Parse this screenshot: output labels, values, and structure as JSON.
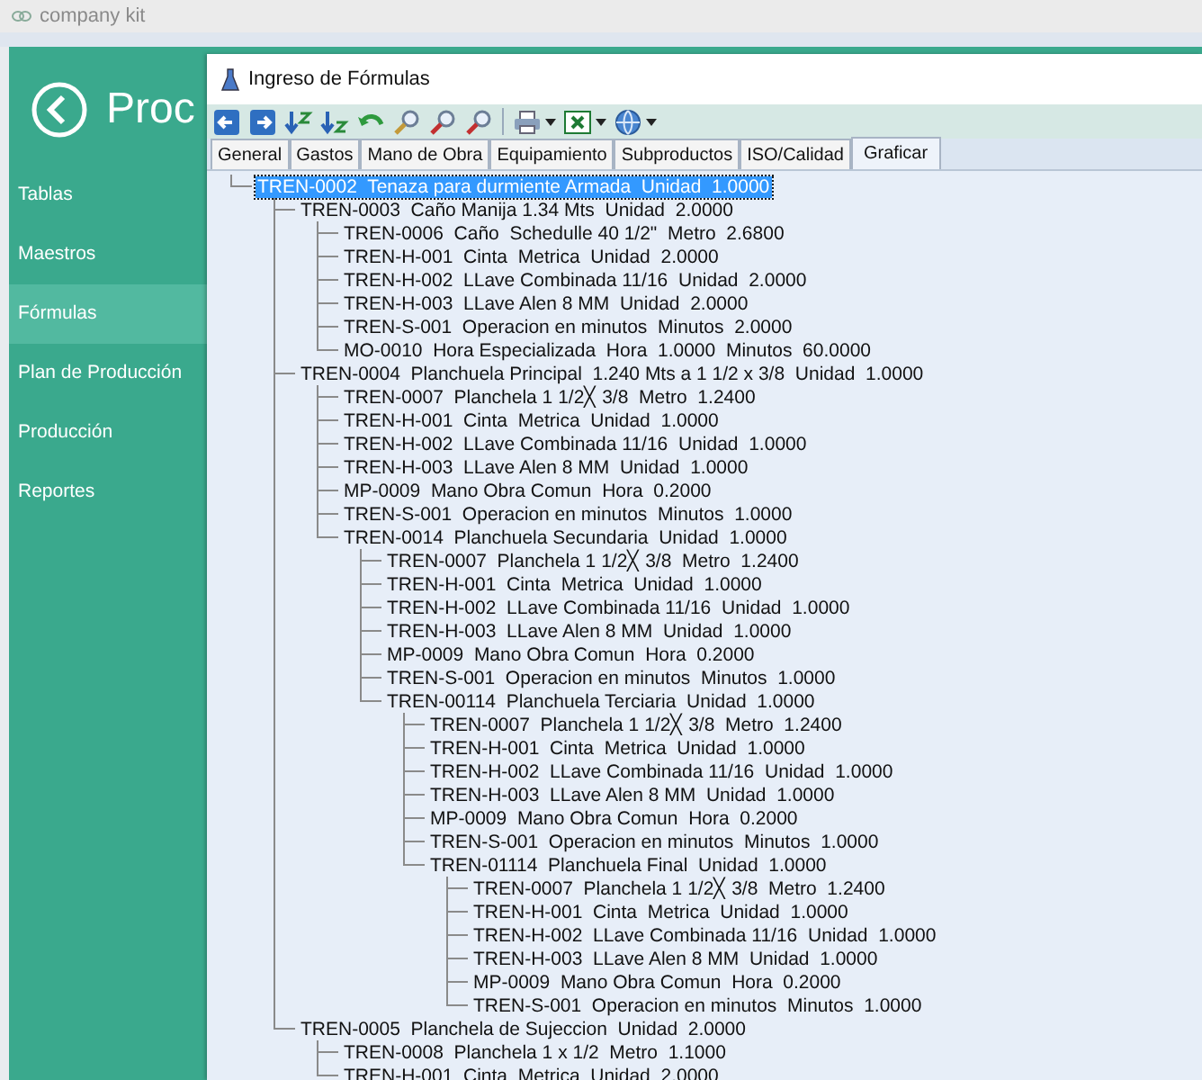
{
  "app_title": "company kit",
  "header": {
    "title": "Proc"
  },
  "sidebar": {
    "items": [
      {
        "label": "Tablas",
        "selected": false
      },
      {
        "label": "Maestros",
        "selected": false
      },
      {
        "label": "Fórmulas",
        "selected": true
      },
      {
        "label": "Plan de Producción",
        "selected": false
      },
      {
        "label": "Producción",
        "selected": false
      },
      {
        "label": "Reportes",
        "selected": false
      }
    ]
  },
  "dialog": {
    "title": "Ingreso de Fórmulas",
    "toolbar": [
      {
        "kind": "nav-left"
      },
      {
        "kind": "nav-right"
      },
      {
        "kind": "sort-asc"
      },
      {
        "kind": "sort-desc"
      },
      {
        "kind": "undo"
      },
      {
        "kind": "search"
      },
      {
        "kind": "search-prev"
      },
      {
        "kind": "search-next"
      },
      {
        "kind": "sep"
      },
      {
        "kind": "printer",
        "dropdown": true
      },
      {
        "kind": "spreadsheet",
        "dropdown": true
      },
      {
        "kind": "globe",
        "dropdown": true
      }
    ],
    "tabs": [
      {
        "label": "General",
        "selected": false
      },
      {
        "label": "Gastos",
        "selected": false
      },
      {
        "label": "Mano de Obra",
        "selected": false
      },
      {
        "label": "Equipamiento",
        "selected": false
      },
      {
        "label": "Subproductos",
        "selected": false
      },
      {
        "label": "ISO/Calidad",
        "selected": false
      },
      {
        "label": "Graficar",
        "selected": true
      }
    ],
    "tree": [
      {
        "label": "TREN-0002  Tenaza para durmiente Armada  Unidad  1.0000",
        "selected": true,
        "children": [
          {
            "label": "TREN-0003  Caño Manija 1.34 Mts  Unidad  2.0000",
            "selected": false,
            "children": [
              {
                "label": "TREN-0006  Caño  Schedulle 40 1/2\"  Metro  2.6800",
                "selected": false
              },
              {
                "label": "TREN-H-001  Cinta  Metrica  Unidad  2.0000",
                "selected": false
              },
              {
                "label": "TREN-H-002  LLave Combinada 11/16  Unidad  2.0000",
                "selected": false
              },
              {
                "label": "TREN-H-003  LLave Alen 8 MM  Unidad  2.0000",
                "selected": false
              },
              {
                "label": "TREN-S-001  Operacion en minutos  Minutos  2.0000",
                "selected": false
              },
              {
                "label": "MO-0010  Hora Especializada  Hora  1.0000  Minutos  60.0000",
                "selected": false
              }
            ]
          },
          {
            "label": "TREN-0004  Planchuela Principal  1.240 Mts a 1 1/2 x 3/8  Unidad  1.0000",
            "selected": false,
            "children": [
              {
                "label": "TREN-0007  Planchela 1 1/2╳ 3/8  Metro  1.2400",
                "selected": false
              },
              {
                "label": "TREN-H-001  Cinta  Metrica  Unidad  1.0000",
                "selected": false
              },
              {
                "label": "TREN-H-002  LLave Combinada 11/16  Unidad  1.0000",
                "selected": false
              },
              {
                "label": "TREN-H-003  LLave Alen 8 MM  Unidad  1.0000",
                "selected": false
              },
              {
                "label": "MP-0009  Mano Obra Comun  Hora  0.2000",
                "selected": false
              },
              {
                "label": "TREN-S-001  Operacion en minutos  Minutos  1.0000",
                "selected": false
              },
              {
                "label": "TREN-0014  Planchuela Secundaria  Unidad  1.0000",
                "selected": false,
                "children": [
                  {
                    "label": "TREN-0007  Planchela 1 1/2╳ 3/8  Metro  1.2400",
                    "selected": false
                  },
                  {
                    "label": "TREN-H-001  Cinta  Metrica  Unidad  1.0000",
                    "selected": false
                  },
                  {
                    "label": "TREN-H-002  LLave Combinada 11/16  Unidad  1.0000",
                    "selected": false
                  },
                  {
                    "label": "TREN-H-003  LLave Alen 8 MM  Unidad  1.0000",
                    "selected": false
                  },
                  {
                    "label": "MP-0009  Mano Obra Comun  Hora  0.2000",
                    "selected": false
                  },
                  {
                    "label": "TREN-S-001  Operacion en minutos  Minutos  1.0000",
                    "selected": false
                  },
                  {
                    "label": "TREN-00114  Planchuela Terciaria  Unidad  1.0000",
                    "selected": false,
                    "children": [
                      {
                        "label": "TREN-0007  Planchela 1 1/2╳ 3/8  Metro  1.2400",
                        "selected": false
                      },
                      {
                        "label": "TREN-H-001  Cinta  Metrica  Unidad  1.0000",
                        "selected": false
                      },
                      {
                        "label": "TREN-H-002  LLave Combinada 11/16  Unidad  1.0000",
                        "selected": false
                      },
                      {
                        "label": "TREN-H-003  LLave Alen 8 MM  Unidad  1.0000",
                        "selected": false
                      },
                      {
                        "label": "MP-0009  Mano Obra Comun  Hora  0.2000",
                        "selected": false
                      },
                      {
                        "label": "TREN-S-001  Operacion en minutos  Minutos  1.0000",
                        "selected": false
                      },
                      {
                        "label": "TREN-01114  Planchuela Final  Unidad  1.0000",
                        "selected": false,
                        "children": [
                          {
                            "label": "TREN-0007  Planchela 1 1/2╳ 3/8  Metro  1.2400",
                            "selected": false
                          },
                          {
                            "label": "TREN-H-001  Cinta  Metrica  Unidad  1.0000",
                            "selected": false
                          },
                          {
                            "label": "TREN-H-002  LLave Combinada 11/16  Unidad  1.0000",
                            "selected": false
                          },
                          {
                            "label": "TREN-H-003  LLave Alen 8 MM  Unidad  1.0000",
                            "selected": false
                          },
                          {
                            "label": "MP-0009  Mano Obra Comun  Hora  0.2000",
                            "selected": false
                          },
                          {
                            "label": "TREN-S-001  Operacion en minutos  Minutos  1.0000",
                            "selected": false
                          }
                        ]
                      }
                    ]
                  }
                ]
              }
            ]
          },
          {
            "label": "TREN-0005  Planchela de Sujeccion  Unidad  2.0000",
            "selected": false,
            "children": [
              {
                "label": "TREN-0008  Planchela 1 x 1/2  Metro  1.1000",
                "selected": false
              },
              {
                "label": "TREN-H-001  Cinta  Metrica  Unidad  2.0000",
                "selected": false
              }
            ]
          }
        ]
      }
    ]
  }
}
